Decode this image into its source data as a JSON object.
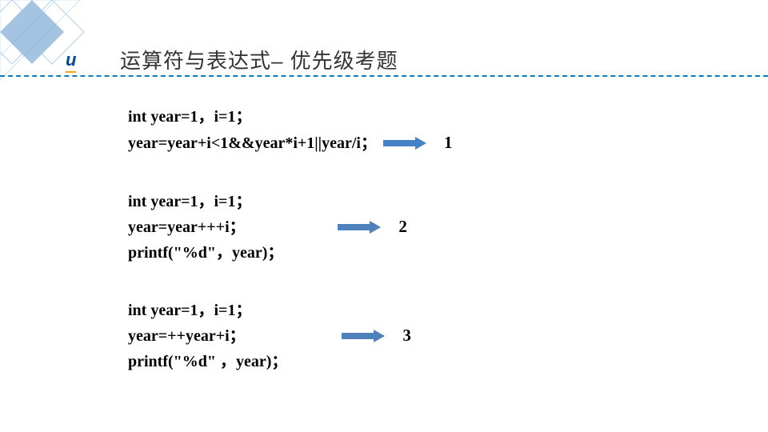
{
  "logo": "u",
  "title": "运算符与表达式– 优先级考题",
  "block1": {
    "line1": "int year=1，i=1；",
    "line2": "year=year+i<1&&year*i+1||year/i；",
    "result": "1"
  },
  "block2": {
    "line1": "int year=1，i=1；",
    "line2": "year=year+++i；",
    "line3": "printf(\"%d\"，year)；",
    "result": "2"
  },
  "block3": {
    "line1": "int year=1，i=1；",
    "line2": "year=++year+i；",
    "line3": "printf(\"%d\" ，year)；",
    "result": "3"
  }
}
